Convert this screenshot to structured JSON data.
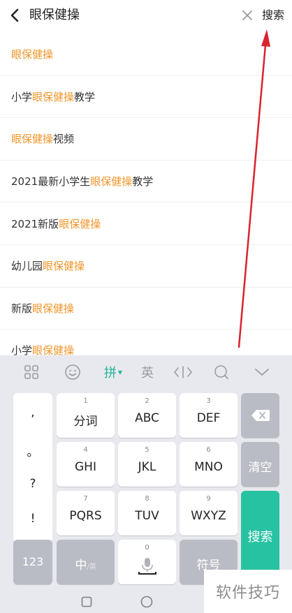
{
  "header": {
    "query": "眼保健操",
    "search_label": "搜索"
  },
  "suggestions": [
    {
      "pre": "",
      "hl": "眼保健操",
      "post": ""
    },
    {
      "pre": "小学",
      "hl": "眼保健操",
      "post": "教学"
    },
    {
      "pre": "",
      "hl": "眼保健操",
      "post": "视频"
    },
    {
      "pre": "2021最新小学生",
      "hl": "眼保健操",
      "post": "教学"
    },
    {
      "pre": "2021新版",
      "hl": "眼保健操",
      "post": ""
    },
    {
      "pre": "幼儿园",
      "hl": "眼保健操",
      "post": ""
    },
    {
      "pre": "新版",
      "hl": "眼保健操",
      "post": ""
    },
    {
      "pre": "小学",
      "hl": "眼保健操",
      "post": ""
    }
  ],
  "colors": {
    "highlight": "#f0962a",
    "keyboard_bg": "#e8e9ee",
    "accent_green": "#27c2a2",
    "annotation_arrow": "#d9232e"
  },
  "keyboard": {
    "toolbar": {
      "grid_icon": "grid-icon",
      "emoji_icon": "emoji-icon",
      "pinyin_label": "拼",
      "english_label": "英",
      "cursor_icon": "cursor-move-icon",
      "search_icon": "search-icon",
      "collapse_icon": "chevron-down-icon"
    },
    "punct": [
      ",",
      "。",
      "?",
      "!"
    ],
    "keys": [
      {
        "num": "1",
        "label": "分词"
      },
      {
        "num": "2",
        "label": "ABC"
      },
      {
        "num": "3",
        "label": "DEF"
      },
      {
        "num": "4",
        "label": "GHI"
      },
      {
        "num": "5",
        "label": "JKL"
      },
      {
        "num": "6",
        "label": "MNO"
      },
      {
        "num": "7",
        "label": "PQRS"
      },
      {
        "num": "8",
        "label": "TUV"
      },
      {
        "num": "9",
        "label": "WXYZ"
      },
      {
        "num": "0",
        "label": ""
      }
    ],
    "clear_label": "清空",
    "search_label": "搜索",
    "num_label": "123",
    "lang_label": "中",
    "lang_sub": "/英",
    "symbol_label": "符号"
  },
  "watermark": "软件技巧"
}
